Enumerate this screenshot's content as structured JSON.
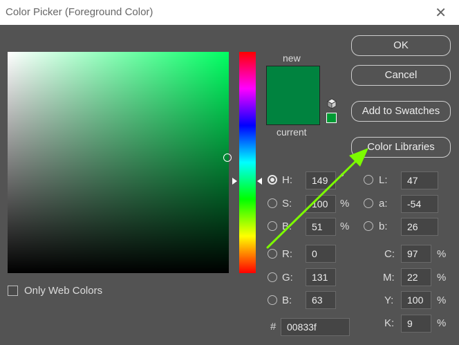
{
  "window": {
    "title": "Color Picker (Foreground Color)",
    "close_glyph": "✕"
  },
  "preview": {
    "new_label": "new",
    "current_label": "current",
    "color": "#00833f"
  },
  "buttons": {
    "ok": "OK",
    "cancel": "Cancel",
    "add_to_swatches": "Add to Swatches",
    "color_libraries": "Color Libraries"
  },
  "only_web_colors": {
    "label": "Only Web Colors",
    "checked": false
  },
  "hsb": {
    "h": {
      "label": "H:",
      "value": "149",
      "unit": "°",
      "selected": true
    },
    "s": {
      "label": "S:",
      "value": "100",
      "unit": "%"
    },
    "b": {
      "label": "B:",
      "value": "51",
      "unit": "%"
    }
  },
  "rgb": {
    "r": {
      "label": "R:",
      "value": "0"
    },
    "g": {
      "label": "G:",
      "value": "131"
    },
    "b": {
      "label": "B:",
      "value": "63"
    }
  },
  "lab": {
    "l": {
      "label": "L:",
      "value": "47"
    },
    "a": {
      "label": "a:",
      "value": "-54"
    },
    "b": {
      "label": "b:",
      "value": "26"
    }
  },
  "cmyk": {
    "c": {
      "label": "C:",
      "value": "97",
      "unit": "%"
    },
    "m": {
      "label": "M:",
      "value": "22",
      "unit": "%"
    },
    "y": {
      "label": "Y:",
      "value": "100",
      "unit": "%"
    },
    "k": {
      "label": "K:",
      "value": "9",
      "unit": "%"
    }
  },
  "hex": {
    "label": "#",
    "value": "00833f"
  },
  "colors": {
    "accent_arrow": "#7cfc00",
    "dialog_bg": "#535353"
  }
}
